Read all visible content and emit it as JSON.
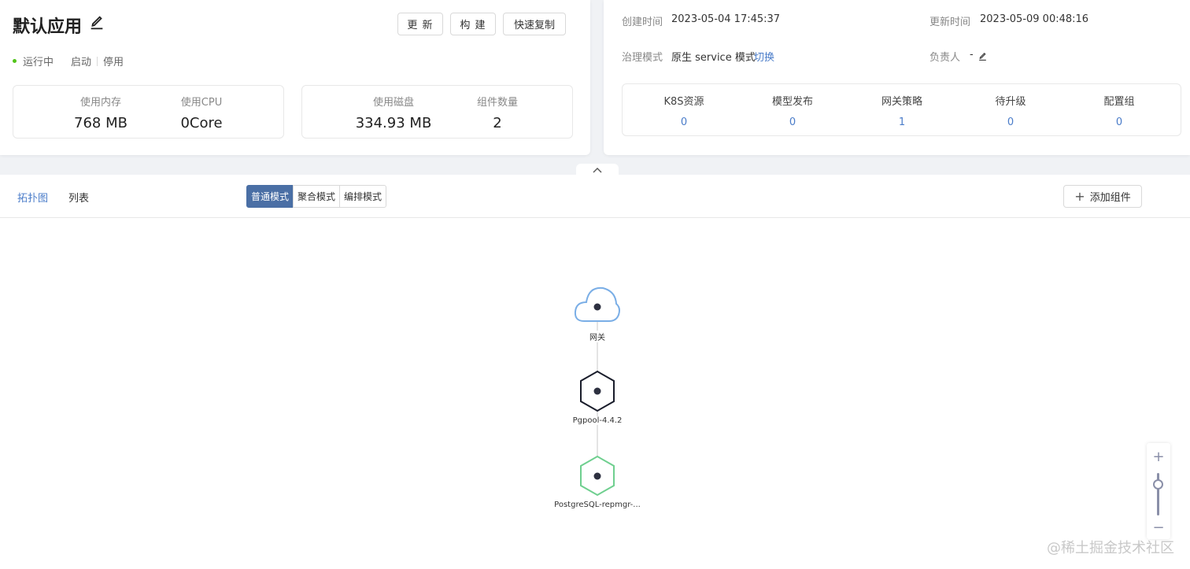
{
  "app": {
    "title": "默认应用",
    "status": "运行中",
    "actions": {
      "start": "启动",
      "stop": "停用"
    },
    "buttons": {
      "update": "更 新",
      "build": "构 建",
      "copy": "快速复制"
    },
    "stats": [
      {
        "label": "使用内存",
        "value": "768 MB"
      },
      {
        "label": "使用CPU",
        "value": "0Core"
      },
      {
        "label": "使用磁盘",
        "value": "334.93 MB"
      },
      {
        "label": "组件数量",
        "value": "2"
      }
    ]
  },
  "info": {
    "created_label": "创建时间",
    "created_value": "2023-05-04 17:45:37",
    "updated_label": "更新时间",
    "updated_value": "2023-05-09 00:48:16",
    "governance_label": "治理模式",
    "governance_value": "原生 service 模式",
    "governance_switch": "切换",
    "owner_label": "负责人",
    "owner_value": "-"
  },
  "resources": [
    {
      "label": "K8S资源",
      "value": "0"
    },
    {
      "label": "模型发布",
      "value": "0"
    },
    {
      "label": "网关策略",
      "value": "1"
    },
    {
      "label": "待升级",
      "value": "0"
    },
    {
      "label": "配置组",
      "value": "0"
    }
  ],
  "toolbar": {
    "tabs": [
      "拓扑图",
      "列表"
    ],
    "modes": [
      "普通模式",
      "聚合模式",
      "编排模式"
    ],
    "add_component": "添加组件"
  },
  "topology": {
    "nodes": [
      {
        "label": "网关",
        "kind": "gateway",
        "color": "#7aaee6"
      },
      {
        "label": "Pgpool-4.4.2",
        "kind": "component",
        "color": "#1a1d2b"
      },
      {
        "label": "PostgreSQL-repmgr-...",
        "kind": "component",
        "color": "#6fcf8f"
      }
    ]
  },
  "zoom": {
    "plus": "+",
    "minus": "−"
  },
  "watermark": "@稀土掘金技术社区",
  "colors": {
    "accent": "#4a7cc9",
    "running": "#52c41a",
    "mode_active": "#4a6fa5"
  }
}
